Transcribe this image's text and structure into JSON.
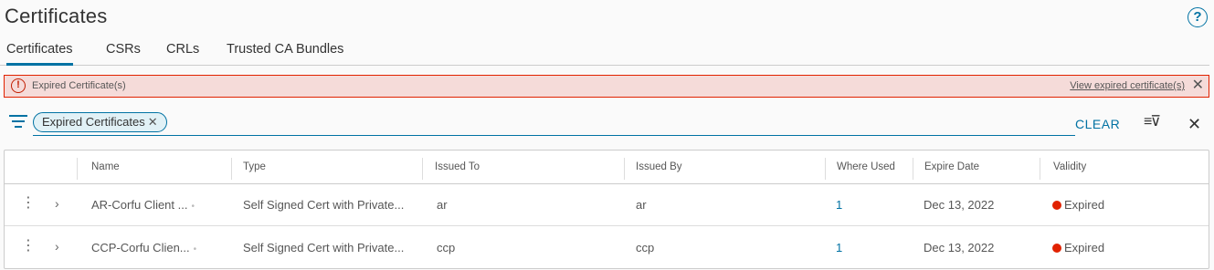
{
  "page": {
    "title": "Certificates"
  },
  "tabs": [
    {
      "label": "Certificates",
      "active": true
    },
    {
      "label": "CSRs"
    },
    {
      "label": "CRLs"
    },
    {
      "label": "Trusted CA Bundles"
    }
  ],
  "alert": {
    "icon": "alert-circle-icon",
    "text": "Expired Certificate(s)",
    "link": "View expired certificate(s)",
    "color": "#e12200"
  },
  "filter": {
    "chip_label": "Expired Certificates",
    "clear_label": "CLEAR"
  },
  "table": {
    "columns": [
      "Name",
      "Type",
      "Issued To",
      "Issued By",
      "Where Used",
      "Expire Date",
      "Validity"
    ],
    "rows": [
      {
        "name": "AR-Corfu Client ...",
        "type": "Self Signed Cert with Private...",
        "issued_to": "ar",
        "issued_by": "ar",
        "where_used": "1",
        "expire_date": "Dec 13, 2022",
        "validity": "Expired"
      },
      {
        "name": "CCP-Corfu Clien...",
        "type": "Self Signed Cert with Private...",
        "issued_to": "ccp",
        "issued_by": "ccp",
        "where_used": "1",
        "expire_date": "Dec 13, 2022",
        "validity": "Expired"
      }
    ]
  },
  "colors": {
    "accent": "#0072a3",
    "danger": "#e12200"
  }
}
